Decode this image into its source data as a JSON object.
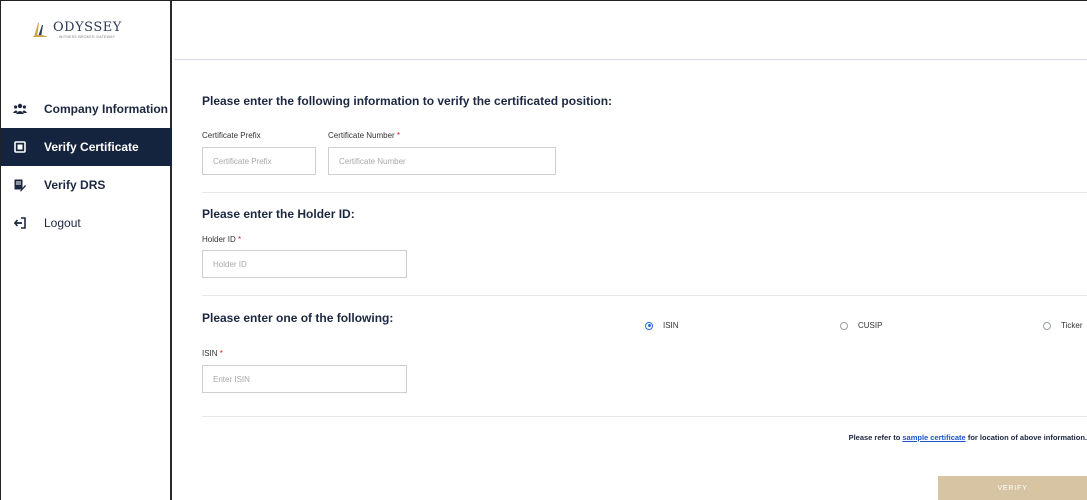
{
  "logo": {
    "name": "ODYSSEY",
    "subtitle": "WITNESS BROKER GATEWAY"
  },
  "sidebar": {
    "items": [
      {
        "label": "Company Information",
        "icon": "users-icon",
        "active": false
      },
      {
        "label": "Verify Certificate",
        "icon": "certificate-icon",
        "active": true
      },
      {
        "label": "Verify DRS",
        "icon": "drs-icon",
        "active": false
      },
      {
        "label": "Logout",
        "icon": "logout-icon",
        "active": false
      }
    ]
  },
  "certificate": {
    "title": "Please enter the following information to verify the certificated position:",
    "prefix_label": "Certificate Prefix",
    "prefix_placeholder": "Certificate Prefix",
    "number_label": "Certificate Number",
    "number_placeholder": "Certificate Number"
  },
  "holder": {
    "title": "Please enter the Holder ID:",
    "label": "Holder ID",
    "placeholder": "Holder ID"
  },
  "identifier": {
    "title": "Please enter one of the following:",
    "options": [
      {
        "label": "ISIN",
        "checked": true
      },
      {
        "label": "CUSIP",
        "checked": false
      },
      {
        "label": "Ticker",
        "checked": false
      }
    ],
    "label": "ISIN",
    "placeholder": "Enter ISIN"
  },
  "help": {
    "prefix": "Please refer to ",
    "link": "sample certificate",
    "suffix": " for location of above information."
  },
  "verify_label": "VERIFY",
  "required_marker": "*",
  "colors": {
    "sidebar_active": "#14233e",
    "verify_button": "#d7c4a2",
    "radio_selected": "#2b6cd6",
    "required": "#dd2222"
  }
}
